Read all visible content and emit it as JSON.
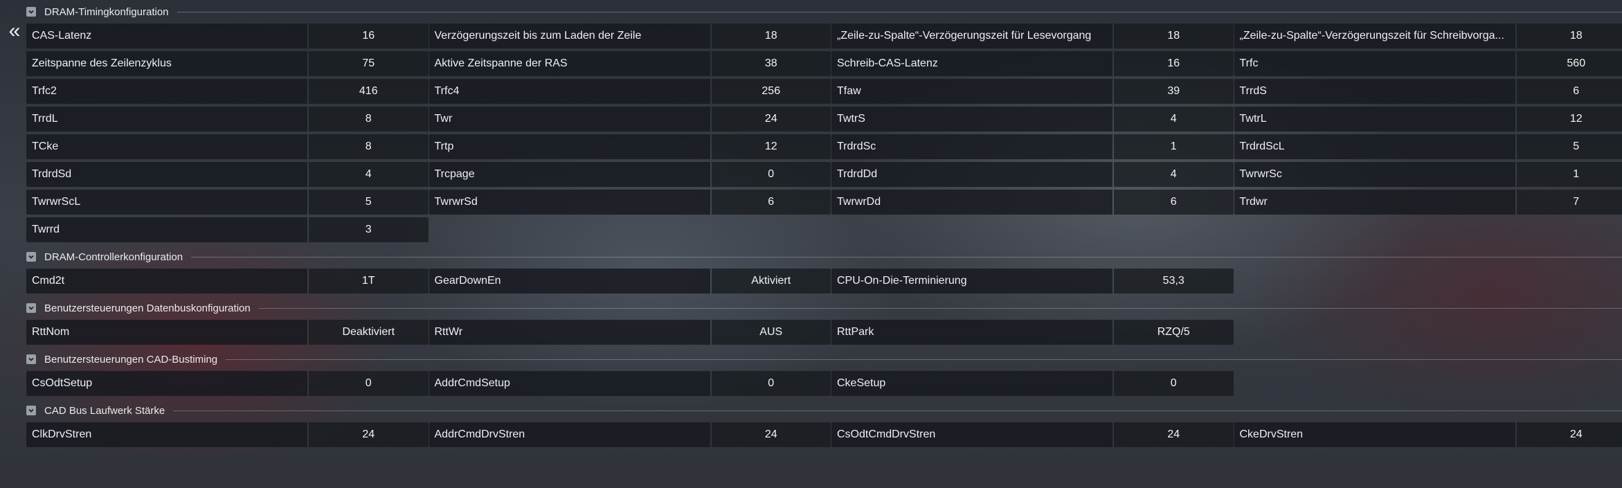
{
  "sections": [
    {
      "title": "DRAM-Timingkonfiguration",
      "items": [
        {
          "label": "CAS-Latenz",
          "value": "16"
        },
        {
          "label": "Verzögerungszeit bis zum Laden der Zeile",
          "value": "18"
        },
        {
          "label": "„Zeile-zu-Spalte“-Verzögerungszeit für Lesevorgang",
          "value": "18"
        },
        {
          "label": "„Zeile-zu-Spalte“-Verzögerungszeit für Schreibvorga...",
          "value": "18"
        },
        {
          "label": "Zeitspanne des Zeilenzyklus",
          "value": "75"
        },
        {
          "label": "Aktive Zeitspanne der RAS",
          "value": "38"
        },
        {
          "label": "Schreib-CAS-Latenz",
          "value": "16"
        },
        {
          "label": "Trfc",
          "value": "560"
        },
        {
          "label": "Trfc2",
          "value": "416"
        },
        {
          "label": "Trfc4",
          "value": "256"
        },
        {
          "label": "Tfaw",
          "value": "39"
        },
        {
          "label": "TrrdS",
          "value": "6"
        },
        {
          "label": "TrrdL",
          "value": "8"
        },
        {
          "label": "Twr",
          "value": "24"
        },
        {
          "label": "TwtrS",
          "value": "4"
        },
        {
          "label": "TwtrL",
          "value": "12"
        },
        {
          "label": "TCke",
          "value": "8"
        },
        {
          "label": "Trtp",
          "value": "12"
        },
        {
          "label": "TrdrdSc",
          "value": "1"
        },
        {
          "label": "TrdrdScL",
          "value": "5"
        },
        {
          "label": "TrdrdSd",
          "value": "4"
        },
        {
          "label": "Trcpage",
          "value": "0"
        },
        {
          "label": "TrdrdDd",
          "value": "4"
        },
        {
          "label": "TwrwrSc",
          "value": "1"
        },
        {
          "label": "TwrwrScL",
          "value": "5"
        },
        {
          "label": "TwrwrSd",
          "value": "6"
        },
        {
          "label": "TwrwrDd",
          "value": "6"
        },
        {
          "label": "Trdwr",
          "value": "7"
        },
        {
          "label": "Twrrd",
          "value": "3"
        }
      ]
    },
    {
      "title": "DRAM-Controllerkonfiguration",
      "items": [
        {
          "label": "Cmd2t",
          "value": "1T"
        },
        {
          "label": "GearDownEn",
          "value": "Aktiviert"
        },
        {
          "label": "CPU-On-Die-Terminierung",
          "value": "53,3"
        }
      ]
    },
    {
      "title": "Benutzersteuerungen Datenbuskonfiguration",
      "items": [
        {
          "label": "RttNom",
          "value": "Deaktiviert"
        },
        {
          "label": "RttWr",
          "value": "AUS"
        },
        {
          "label": "RttPark",
          "value": "RZQ/5"
        }
      ]
    },
    {
      "title": "Benutzersteuerungen CAD-Bustiming",
      "items": [
        {
          "label": "CsOdtSetup",
          "value": "0"
        },
        {
          "label": "AddrCmdSetup",
          "value": "0"
        },
        {
          "label": "CkeSetup",
          "value": "0"
        }
      ]
    },
    {
      "title": "CAD Bus Laufwerk Stärke",
      "items": [
        {
          "label": "ClkDrvStren",
          "value": "24"
        },
        {
          "label": "AddrCmdDrvStren",
          "value": "24"
        },
        {
          "label": "CsOdtCmdDrvStren",
          "value": "24"
        },
        {
          "label": "CkeDrvStren",
          "value": "24"
        }
      ]
    }
  ],
  "icons": {
    "collapse_panel": "double-chevron-left-icon",
    "section_toggle": "chevron-down-icon"
  }
}
